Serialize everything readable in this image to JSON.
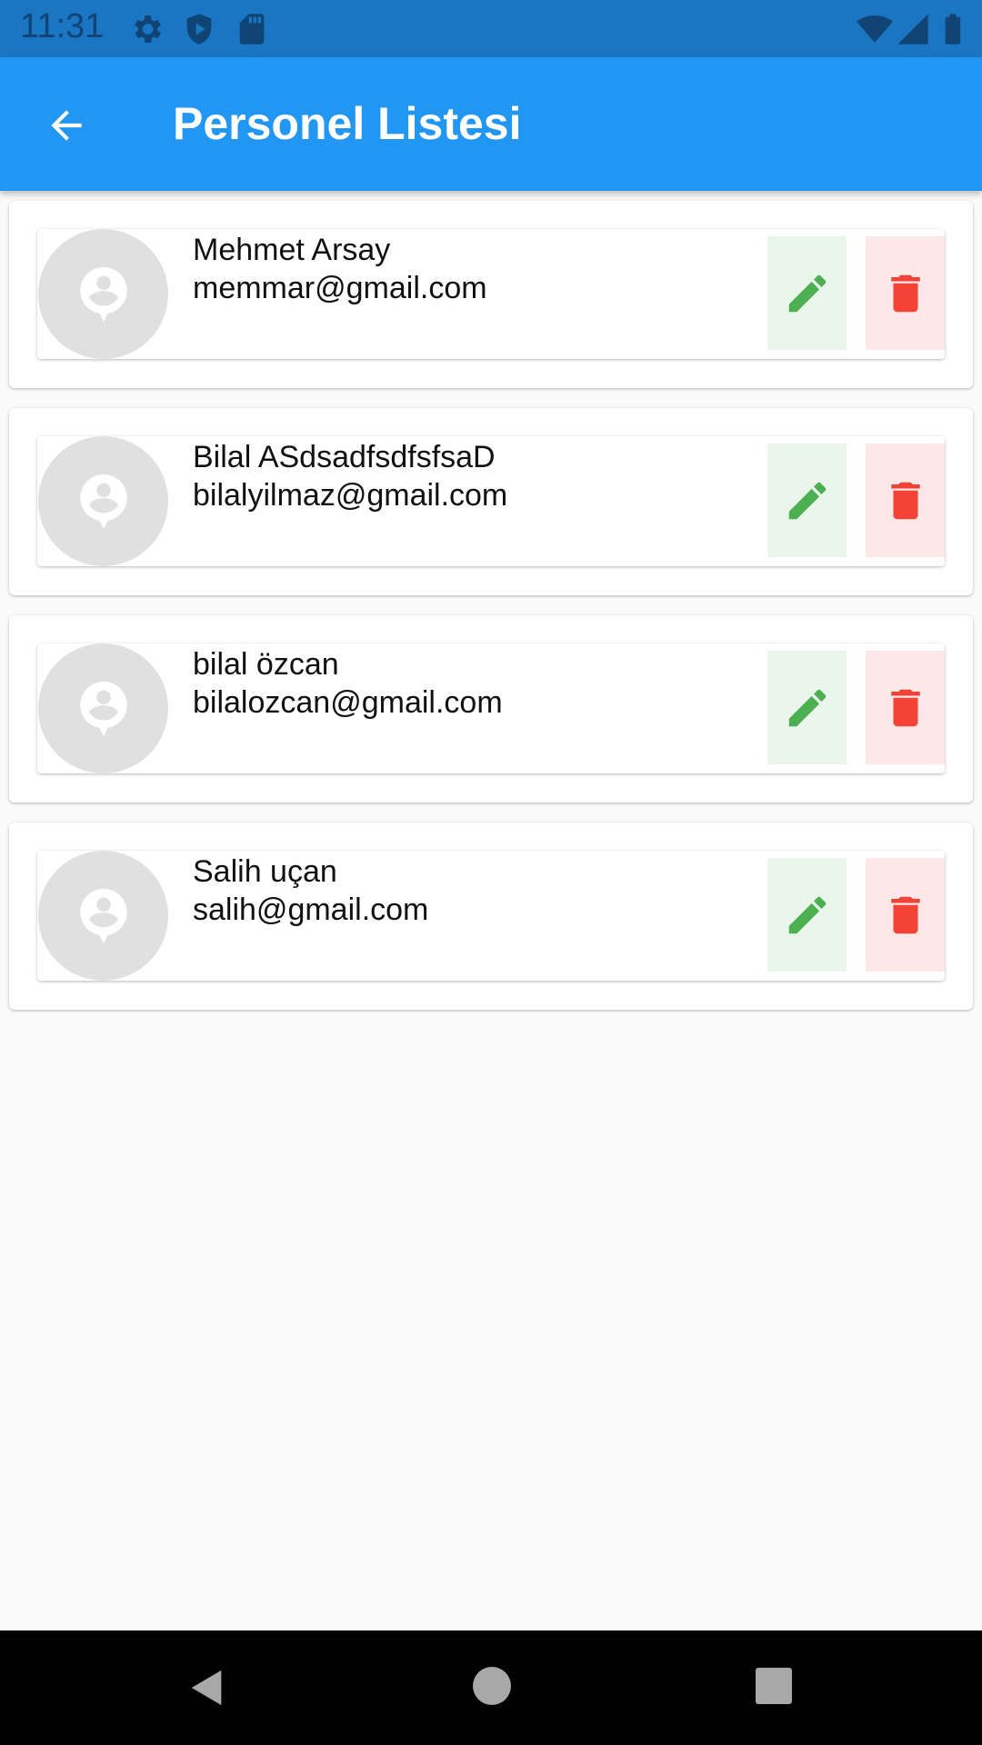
{
  "status_bar": {
    "time": "11:31",
    "icons": [
      "settings-icon",
      "shield-icon",
      "sd-card-icon",
      "wifi-icon",
      "signal-icon",
      "battery-icon"
    ]
  },
  "app_bar": {
    "title": "Personel Listesi",
    "back_icon": "arrow-back-icon",
    "color": "#2196f3"
  },
  "employees": [
    {
      "name": "Mehmet Arsay",
      "email": "memmar@gmail.com"
    },
    {
      "name": "Bilal ASdsadfsdfsfsaD",
      "email": "bilalyilmaz@gmail.com"
    },
    {
      "name": "bilal özcan",
      "email": "bilalozcan@gmail.com"
    },
    {
      "name": "Salih uçan",
      "email": "salih@gmail.com"
    }
  ],
  "actions": {
    "edit_icon": "pencil-icon",
    "edit_color": "#4caf50",
    "delete_icon": "trash-icon",
    "delete_color": "#f44336"
  },
  "nav_bar": {
    "icons": [
      "nav-back-icon",
      "nav-home-icon",
      "nav-recents-icon"
    ]
  }
}
